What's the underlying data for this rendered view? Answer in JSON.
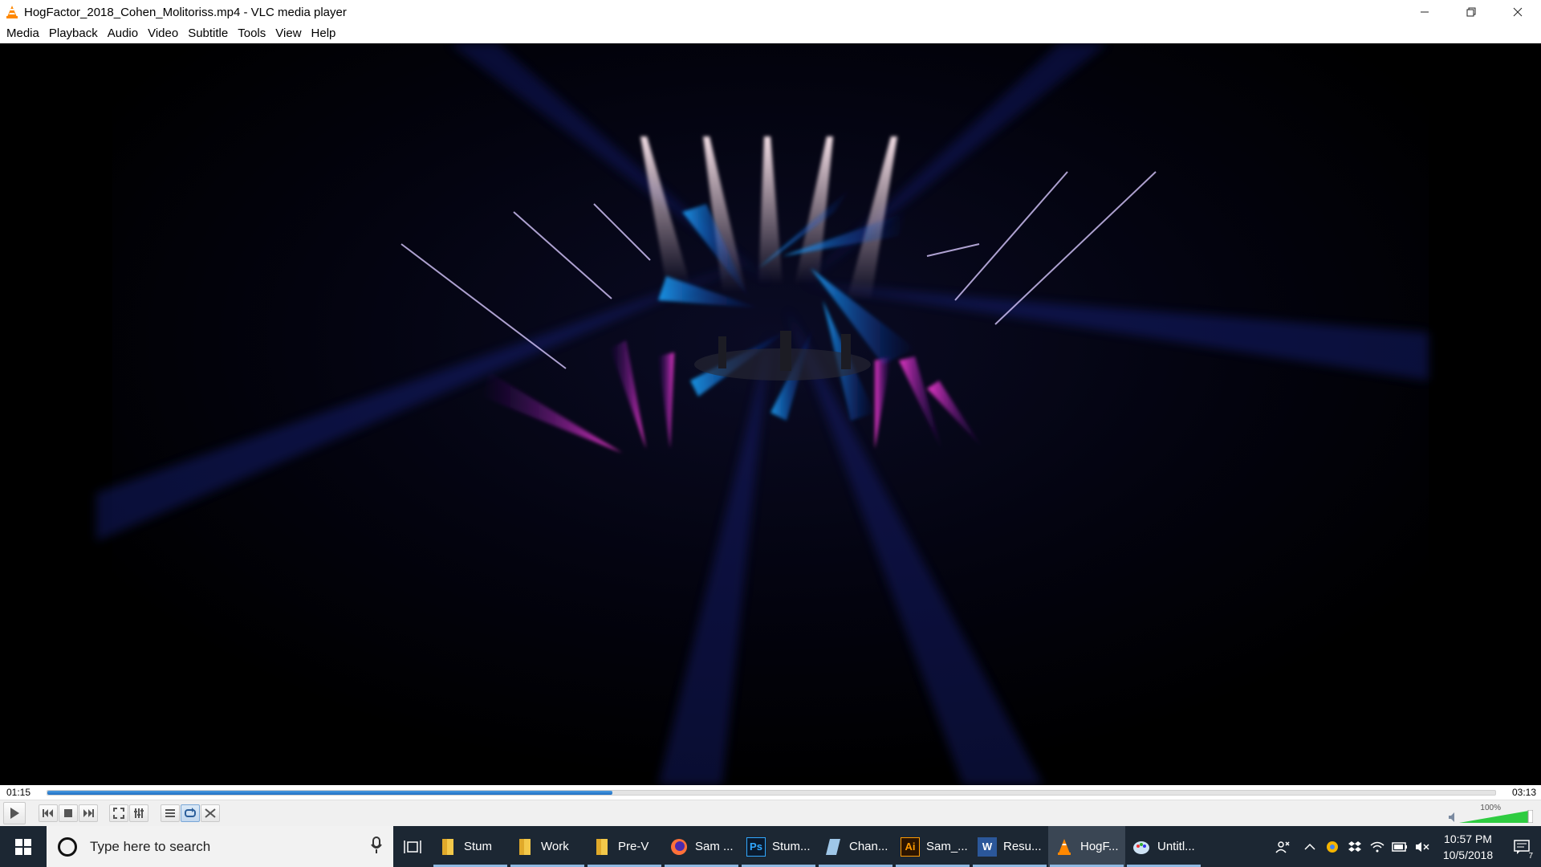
{
  "window": {
    "title": "HogFactor_2018_Cohen_Molitoriss.mp4 - VLC media player",
    "controls": [
      "minimize",
      "restore",
      "close"
    ]
  },
  "menu": [
    "Media",
    "Playback",
    "Audio",
    "Video",
    "Subtitle",
    "Tools",
    "View",
    "Help"
  ],
  "playback": {
    "elapsed": "01:15",
    "total": "03:13",
    "progress": 0.39,
    "volume_label": "100%",
    "volume": 1.0
  },
  "controls": {
    "buttons": [
      "play-icon",
      "previous-icon",
      "stop-icon",
      "next-icon",
      "fullscreen-icon",
      "extended-settings-icon",
      "playlist-icon",
      "loop-icon",
      "shuffle-icon"
    ]
  },
  "taskbar": {
    "search_placeholder": "Type here to search",
    "apps": [
      {
        "label": "Stum",
        "icon": "folder-icon",
        "color": "#f3c84a"
      },
      {
        "label": "Work",
        "icon": "folder-icon",
        "color": "#f3c84a"
      },
      {
        "label": "Pre-V",
        "icon": "folder-icon",
        "color": "#f3c84a"
      },
      {
        "label": "Sam ...",
        "icon": "firefox-icon",
        "color": "#ff7139"
      },
      {
        "label": "Stum...",
        "icon": "photoshop-icon",
        "color": "#31a8ff"
      },
      {
        "label": "Chan...",
        "icon": "document-icon",
        "color": "#9fc7e8"
      },
      {
        "label": "Sam_...",
        "icon": "illustrator-icon",
        "color": "#ff9a00"
      },
      {
        "label": "Resu...",
        "icon": "word-icon",
        "color": "#2b579a"
      },
      {
        "label": "HogF...",
        "icon": "vlc-icon",
        "color": "#ff8800"
      },
      {
        "label": "Untitl...",
        "icon": "paint-icon",
        "color": "#cfe3f5"
      }
    ],
    "tray": {
      "time": "10:57 PM",
      "date": "10/5/2018",
      "notifications": "7"
    }
  }
}
